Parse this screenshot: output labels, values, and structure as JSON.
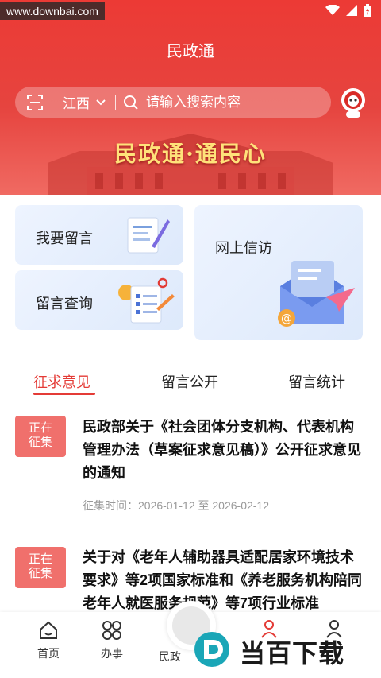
{
  "statusbar": {
    "watermark": "www.downbai.com"
  },
  "header": {
    "title": "民政通",
    "region": "江西",
    "search_placeholder": "请输入搜索内容",
    "slogan": "民政通·通民心"
  },
  "cards": [
    {
      "label": "我要留言"
    },
    {
      "label": "留言查询"
    },
    {
      "label": "网上信访"
    }
  ],
  "tabs": [
    {
      "label": "征求意见",
      "active": true
    },
    {
      "label": "留言公开",
      "active": false
    },
    {
      "label": "留言统计",
      "active": false
    }
  ],
  "items": [
    {
      "badge_line1": "正在",
      "badge_line2": "征集",
      "title": "民政部关于《社会团体分支机构、代表机构管理办法（草案征求意见稿）》公开征求意见的通知",
      "date": "征集时间：2026-01-12 至 2026-02-12"
    },
    {
      "badge_line1": "正在",
      "badge_line2": "征集",
      "title": "关于对《老年人辅助器具适配居家环境技术要求》等2项国家标准和《养老服务机构陪同老年人就医服务规范》等7项行业标准"
    }
  ],
  "tabbar": {
    "home": "首页",
    "services": "办事",
    "center": "民政"
  },
  "brand": {
    "text": "当百下载"
  },
  "colors": {
    "primary": "#e43b36",
    "badge": "#f0706c"
  }
}
